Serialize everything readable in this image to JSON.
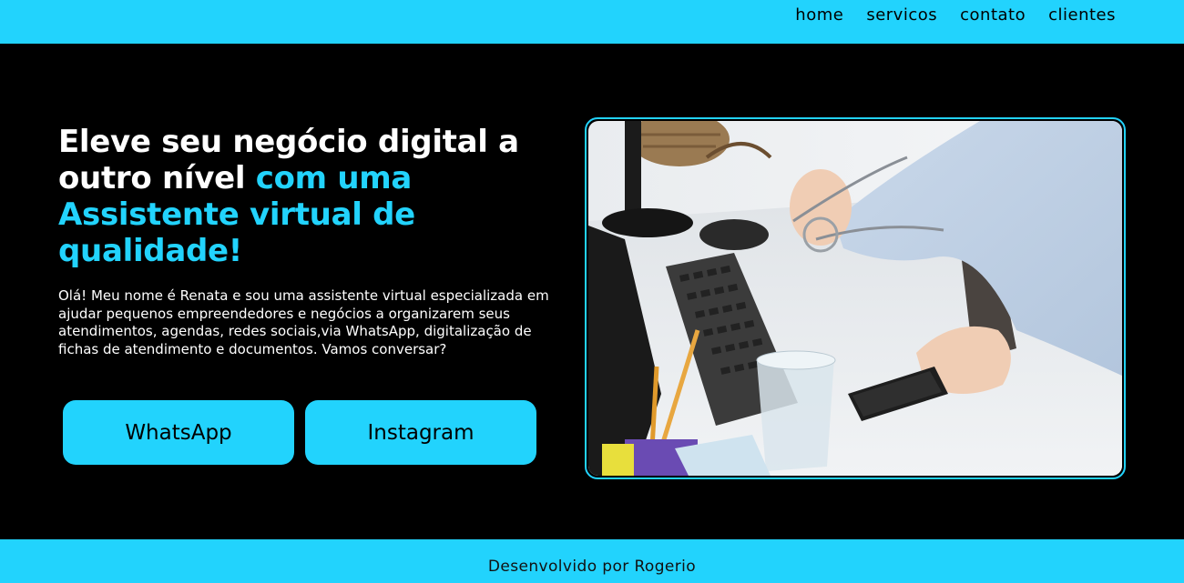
{
  "nav": {
    "items": [
      "home",
      "servicos",
      "contato",
      "clientes"
    ]
  },
  "hero": {
    "title_white": "Eleve seu negócio digital a outro nível ",
    "title_accent": "com uma Assistente virtual de qualidade!",
    "intro": "Olá! Meu nome é Renata e sou uma assistente virtual especializada em ajudar pequenos empreendedores e negócios a organizarem seus atendimentos, agendas, redes sociais,via WhatsApp, digitalização de fichas de atendimento e documentos. Vamos conversar?",
    "buttons": {
      "whatsapp": "WhatsApp",
      "instagram": "Instagram"
    }
  },
  "footer": {
    "credit": "Desenvolvido por Rogerio"
  },
  "colors": {
    "accent": "#22d3fd",
    "background": "#000000"
  },
  "image": {
    "icon": "office-desk-photo"
  }
}
